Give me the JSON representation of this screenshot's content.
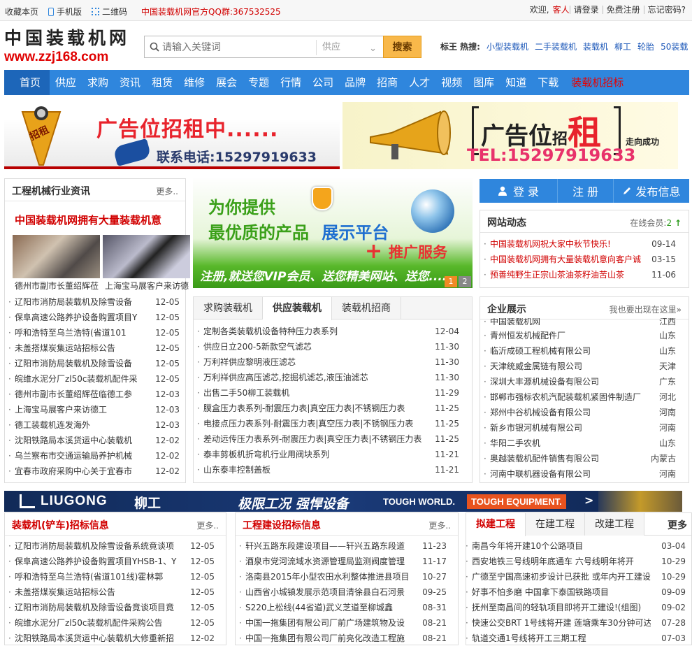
{
  "topbar": {
    "bookmark": "收藏本页",
    "mobile": "手机版",
    "qrcode": "二维码",
    "qq_group": "中国装载机网官方QQ群:367532525",
    "welcome": "欢迎,",
    "guest": "客人",
    "login": "请登录",
    "register": "免费注册",
    "forgot": "忘记密码?"
  },
  "logo": {
    "cn": "中国装载机网",
    "en": "www.zzj168.com"
  },
  "search": {
    "placeholder": "请输入关键词",
    "type": "供应",
    "button": "搜索"
  },
  "hot": {
    "label": "标王 热搜:",
    "items": [
      "小型装载机",
      "二手装载机",
      "装载机",
      "柳工",
      "轮胎",
      "50装载"
    ]
  },
  "nav": [
    "首页",
    "供应",
    "求购",
    "资讯",
    "租赁",
    "维修",
    "展会",
    "专题",
    "行情",
    "公司",
    "品牌",
    "招商",
    "人才",
    "视频",
    "图库",
    "知道",
    "下载",
    "装载机招标"
  ],
  "banners": {
    "left": {
      "title": "广告位招租中......",
      "phone": "联系电话:15297919633",
      "badge": "招租"
    },
    "right": {
      "title1": "广告位",
      "title2": "招",
      "title3": "租",
      "slogan": "走向成功",
      "phone": "TEL:15297919633"
    }
  },
  "news": {
    "title": "工程机械行业资讯",
    "more": "更多..",
    "headline": "中国装载机网拥有大量装载机意",
    "photos": [
      "德州市副市长董绍辉莅",
      "上海宝马展客户来访德"
    ],
    "items": [
      {
        "t": "辽阳市消防局装载机及除雪设备",
        "d": "12-05"
      },
      {
        "t": "保阜高速公路养护设备购置项目Y",
        "d": "12-05"
      },
      {
        "t": "呼和浩特至乌兰浩特(省道101",
        "d": "12-05"
      },
      {
        "t": "未盖搭煤炭集运站招标公告",
        "d": "12-05"
      },
      {
        "t": "辽阳市消防局装载机及除雪设备",
        "d": "12-05"
      },
      {
        "t": "皖维水泥分厂zl50c装载机配件采",
        "d": "12-05"
      },
      {
        "t": "德州市副市长董绍辉莅临德工参",
        "d": "12-03"
      },
      {
        "t": "上海宝马展客户来访德工",
        "d": "12-03"
      },
      {
        "t": "德工装载机连发海外",
        "d": "12-03"
      },
      {
        "t": "沈阳铁路局本溪货运中心装载机",
        "d": "12-02"
      },
      {
        "t": "乌兰察布市交通运输局养护机械",
        "d": "12-02"
      },
      {
        "t": "宜春市政府采购中心关于宜春市",
        "d": "12-02"
      }
    ]
  },
  "promo": {
    "line1": "为你提供",
    "line2a": "最优质的产品",
    "line2b": "展示平台",
    "line3": "推广服务",
    "bottom": "注册,就送您VIP会员、送您精美网站、送您......",
    "pages": [
      "1",
      "2"
    ]
  },
  "supply": {
    "tabs": [
      "求购装载机",
      "供应装载机",
      "装载机招商"
    ],
    "items": [
      {
        "t": "定制各类装载机设备特种压力表系列",
        "d": "12-04"
      },
      {
        "t": "供应日立200-5新款空气滤芯",
        "d": "11-30"
      },
      {
        "t": "万利祥供应黎明液压滤芯",
        "d": "11-30"
      },
      {
        "t": "万利祥供应高压滤芯,挖掘机滤芯,液压油滤芯",
        "d": "11-30"
      },
      {
        "t": "出售二手50柳工装载机",
        "d": "11-29"
      },
      {
        "t": "膜盒压力表系列-耐震压力表|真空压力表|不锈钢压力表",
        "d": "11-25"
      },
      {
        "t": "电接点压力表系列-耐震压力表|真空压力表|不锈钢压力表",
        "d": "11-25"
      },
      {
        "t": "差动远传压力表系列-耐震压力表|真空压力表|不锈钢压力表",
        "d": "11-25"
      },
      {
        "t": "泰丰剪板机折弯机行业用阀块系列",
        "d": "11-21"
      },
      {
        "t": "山东泰丰控制盖板",
        "d": "11-21"
      }
    ]
  },
  "account": {
    "login": "登 录",
    "register": "注 册",
    "publish": "发布信息"
  },
  "sitenews": {
    "title": "网站动态",
    "online_label": "在线会员:",
    "online_count": "2",
    "items": [
      {
        "t": "中国装载机网祝大家中秋节快乐!",
        "d": "09-14"
      },
      {
        "t": "中国装载机网拥有大量装载机意向客户诚",
        "d": "03-15"
      },
      {
        "t": "预善纯野生正宗山茶油茶籽油苦山茶",
        "d": "11-06"
      }
    ]
  },
  "companies": {
    "title": "企业展示",
    "more": "我也要出现在这里»",
    "items": [
      {
        "t": "中国装载机网",
        "p": "江西"
      },
      {
        "t": "青州恒发机械配件厂",
        "p": "山东"
      },
      {
        "t": "临沂成硕工程机械有限公司",
        "p": "山东"
      },
      {
        "t": "天津统威金属链有限公司",
        "p": "天津"
      },
      {
        "t": "深圳大丰源机械设备有限公司",
        "p": "广东"
      },
      {
        "t": "邯郸市强标农机汽配装载机紧固件制造厂",
        "p": "河北"
      },
      {
        "t": "郑州中谷机械设备有限公司",
        "p": "河南"
      },
      {
        "t": "新乡市银河机械有限公司",
        "p": "河南"
      },
      {
        "t": "华阳二手农机",
        "p": "山东"
      },
      {
        "t": "奥越装载机配件销售有限公司",
        "p": "内蒙古"
      },
      {
        "t": "河南中联机器设备有限公司",
        "p": "河南"
      }
    ]
  },
  "liugong": {
    "en": "LIUGONG",
    "cn": "柳工",
    "slogan": "极限工况 强悍设备",
    "tough1": "TOUGH WORLD.",
    "tough2": "TOUGH EQUIPMENT."
  },
  "bid": {
    "title": "装载机(铲车)招标信息",
    "more": "更多..",
    "items": [
      {
        "t": "辽阳市消防局装载机及除雪设备系统竟谈项",
        "d": "12-05"
      },
      {
        "t": "保阜高速公路养护设备购置项目YHSB-1、Y",
        "d": "12-05"
      },
      {
        "t": "呼和浩特至乌兰浩特(省道101线)霍林郭",
        "d": "12-05"
      },
      {
        "t": "未盖搭煤炭集运站招标公告",
        "d": "12-05"
      },
      {
        "t": "辽阳市消防局装载机及除雪设备竟谈项目竟",
        "d": "12-05"
      },
      {
        "t": "皖维水泥分厂zl50c装载机配件采购公告",
        "d": "12-05"
      },
      {
        "t": "沈阳铁路局本溪货运中心装载机大修重新招",
        "d": "12-02"
      }
    ]
  },
  "engbid": {
    "title": "工程建设招标信息",
    "more": "更多..",
    "items": [
      {
        "t": "轩兴五路东段建设项目——轩兴五路东段道",
        "d": "11-23"
      },
      {
        "t": "酒泉市党河流域水资源管理局监测阀度管理",
        "d": "11-17"
      },
      {
        "t": "洛南县2015年小型农田水利整体推进县项目",
        "d": "10-27"
      },
      {
        "t": "山西省小城镇发展示范项目清徐县白石河景",
        "d": "09-25"
      },
      {
        "t": "S220上松线(44省道)武义芝道至柳城鑫",
        "d": "08-31"
      },
      {
        "t": "中国一拖集团有限公司厂前广场建筑物及设",
        "d": "08-21"
      },
      {
        "t": "中国一拖集团有限公司厂前亮化改造工程施",
        "d": "08-21"
      }
    ]
  },
  "projects": {
    "tabs": [
      "拟建工程",
      "在建工程",
      "改建工程"
    ],
    "more": "更多",
    "items": [
      {
        "t": "南昌今年将开建10个公路项目",
        "d": "03-04"
      },
      {
        "t": "西安地铁三号线明年底通车 六号线明年将开",
        "d": "10-29"
      },
      {
        "t": "广德至宁国高速初步设计已获批 或年内开工建设",
        "d": "10-29"
      },
      {
        "t": "好事不怕多磨 中国拿下泰国铁路项目",
        "d": "09-09"
      },
      {
        "t": "抚州至南昌间的轻轨项目即将开工建设!(组图)",
        "d": "09-02"
      },
      {
        "t": "快速公交BRT 1号线将开建 莲塘乘车30分钟可达",
        "d": "07-28"
      },
      {
        "t": "轨道交通1号线将开工三期工程",
        "d": "07-03"
      }
    ]
  },
  "colors": {
    "nav": "#2f86dd",
    "nav_active": "#1d66b9",
    "accent_red": "#d10000",
    "search_button": "#f8b84a",
    "account_blue": "#2f86dd",
    "liugong_bar": "#15356c"
  }
}
